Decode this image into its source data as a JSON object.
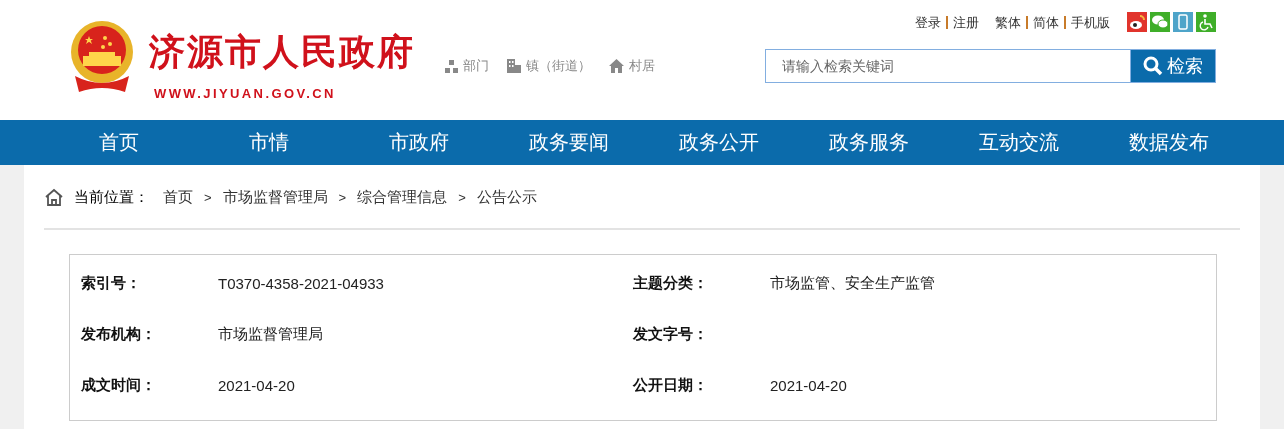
{
  "header": {
    "title": "济源市人民政府",
    "url": "WWW.JIYUAN.GOV.CN",
    "quick_links": [
      {
        "kind": "department",
        "label": "部门"
      },
      {
        "kind": "town",
        "label": "镇（街道）"
      },
      {
        "kind": "village",
        "label": "村居"
      }
    ],
    "top_link_groups": [
      {
        "links": [
          "登录",
          "注册"
        ]
      },
      {
        "links": [
          "繁体",
          "简体",
          "手机版"
        ]
      }
    ],
    "search": {
      "placeholder": "请输入检索关键词",
      "button": "检索"
    }
  },
  "nav": [
    "首页",
    "市情",
    "市政府",
    "政务要闻",
    "政务公开",
    "政务服务",
    "互动交流",
    "数据发布"
  ],
  "breadcrumb": {
    "label": "当前位置：",
    "separator": ">",
    "items": [
      "首页",
      "市场监督管理局",
      "综合管理信息",
      "公告公示"
    ]
  },
  "info": [
    [
      {
        "label": "索引号：",
        "value": "T0370-4358-2021-04933"
      },
      {
        "label": "主题分类：",
        "value": "市场监管、安全生产监管"
      }
    ],
    [
      {
        "label": "发布机构：",
        "value": "市场监督管理局"
      },
      {
        "label": "发文字号："
      }
    ],
    [
      {
        "label": "成文时间：",
        "value": "2021-04-20"
      },
      {
        "label": "公开日期：",
        "value": "2021-04-20"
      }
    ]
  ]
}
